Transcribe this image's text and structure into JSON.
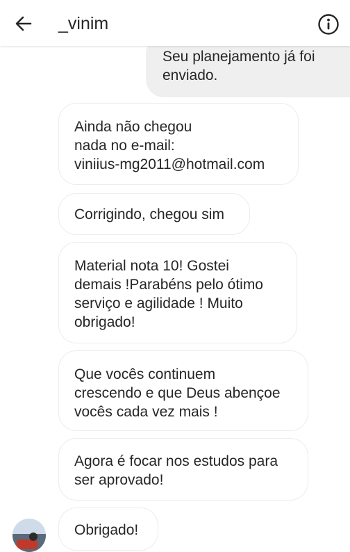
{
  "header": {
    "username": "_vinim",
    "back_icon": "arrow-left-icon",
    "info_icon": "info-circle-icon"
  },
  "messages": [
    {
      "direction": "outgoing",
      "text": "Seu planejamento já foi\nenviado."
    },
    {
      "direction": "incoming",
      "text": "Ainda não chegou\nnada no e-mail:\nviniius-mg2011@hotmail.com"
    },
    {
      "direction": "incoming",
      "text": "Corrigindo, chegou sim"
    },
    {
      "direction": "incoming",
      "text": "Material nota 10! Gostei\ndemais !Parabéns pelo ótimo\nserviço e agilidade ! Muito\nobrigado!"
    },
    {
      "direction": "incoming",
      "text": "Que vocês continuem\ncrescendo e que Deus abençoe\nvocês cada vez mais !"
    },
    {
      "direction": "incoming",
      "text": "Agora é focar nos estudos para\nser aprovado!"
    },
    {
      "direction": "incoming",
      "text": "Obrigado!"
    }
  ],
  "colors": {
    "outgoing_bubble": "#efefef",
    "incoming_border": "#ececec",
    "text": "#262626"
  }
}
